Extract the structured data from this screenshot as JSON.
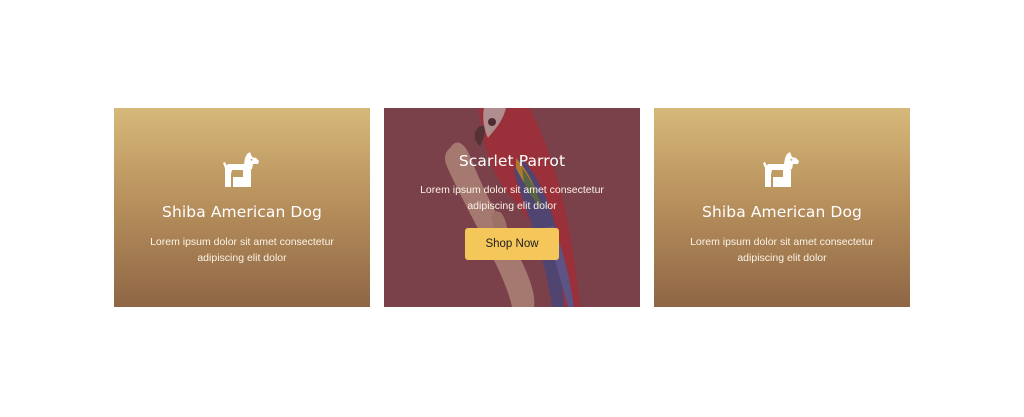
{
  "cards": [
    {
      "icon": "dog-icon",
      "title": "Shiba American Dog",
      "description": "Lorem ipsum dolor sit amet consectetur adipiscing elit dolor"
    },
    {
      "image": "scarlet-parrot-image",
      "title": "Scarlet Parrot",
      "description": "Lorem ipsum dolor sit amet consectetur adipiscing elit dolor",
      "button_label": "Shop Now"
    },
    {
      "icon": "dog-icon",
      "title": "Shiba American Dog",
      "description": "Lorem ipsum dolor sit amet consectetur adipiscing elit dolor"
    }
  ],
  "colors": {
    "card_gradient_top": "#d6b87a",
    "card_gradient_bottom": "#8f6645",
    "overlay": "#7b4850",
    "button": "#f5c659"
  }
}
